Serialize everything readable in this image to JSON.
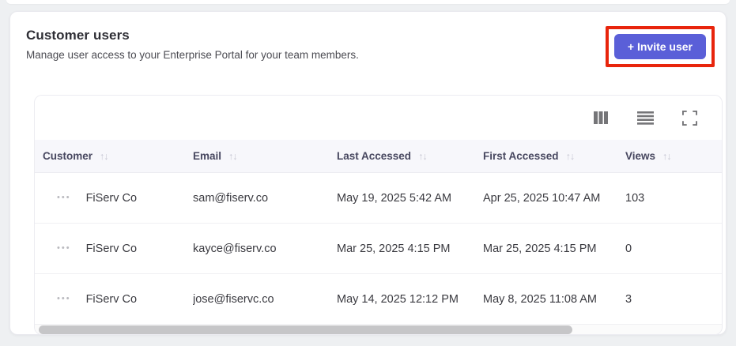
{
  "card": {
    "title": "Customer users",
    "subtitle": "Manage user access to your Enterprise Portal for your team members.",
    "invite_button": {
      "label": "+ Invite user"
    }
  },
  "toolbar": {
    "icons": [
      "columns-icon",
      "density-icon",
      "fullscreen-icon"
    ]
  },
  "icons": {
    "sort": "↑↓",
    "row_menu": "•••"
  },
  "table": {
    "columns": [
      {
        "key": "customer",
        "label": "Customer"
      },
      {
        "key": "email",
        "label": "Email"
      },
      {
        "key": "last_accessed",
        "label": "Last Accessed"
      },
      {
        "key": "first_accessed",
        "label": "First Accessed"
      },
      {
        "key": "views",
        "label": "Views"
      }
    ],
    "rows": [
      {
        "customer": "FiServ Co",
        "email": "sam@fiserv.co",
        "last_accessed": "May 19, 2025 5:42 AM",
        "first_accessed": "Apr 25, 2025 10:47 AM",
        "views": "103"
      },
      {
        "customer": "FiServ Co",
        "email": "kayce@fiserv.co",
        "last_accessed": "Mar 25, 2025 4:15 PM",
        "first_accessed": "Mar 25, 2025 4:15 PM",
        "views": "0"
      },
      {
        "customer": "FiServ Co",
        "email": "jose@fiservc.co",
        "last_accessed": "May 14, 2025 12:12 PM",
        "first_accessed": "May 8, 2025 11:08 AM",
        "views": "3"
      }
    ]
  },
  "colors": {
    "accent": "#5a5fd8",
    "annotation_red": "#e8250c",
    "header_bg": "#f7f7fb",
    "page_bg": "#eef0f2"
  }
}
